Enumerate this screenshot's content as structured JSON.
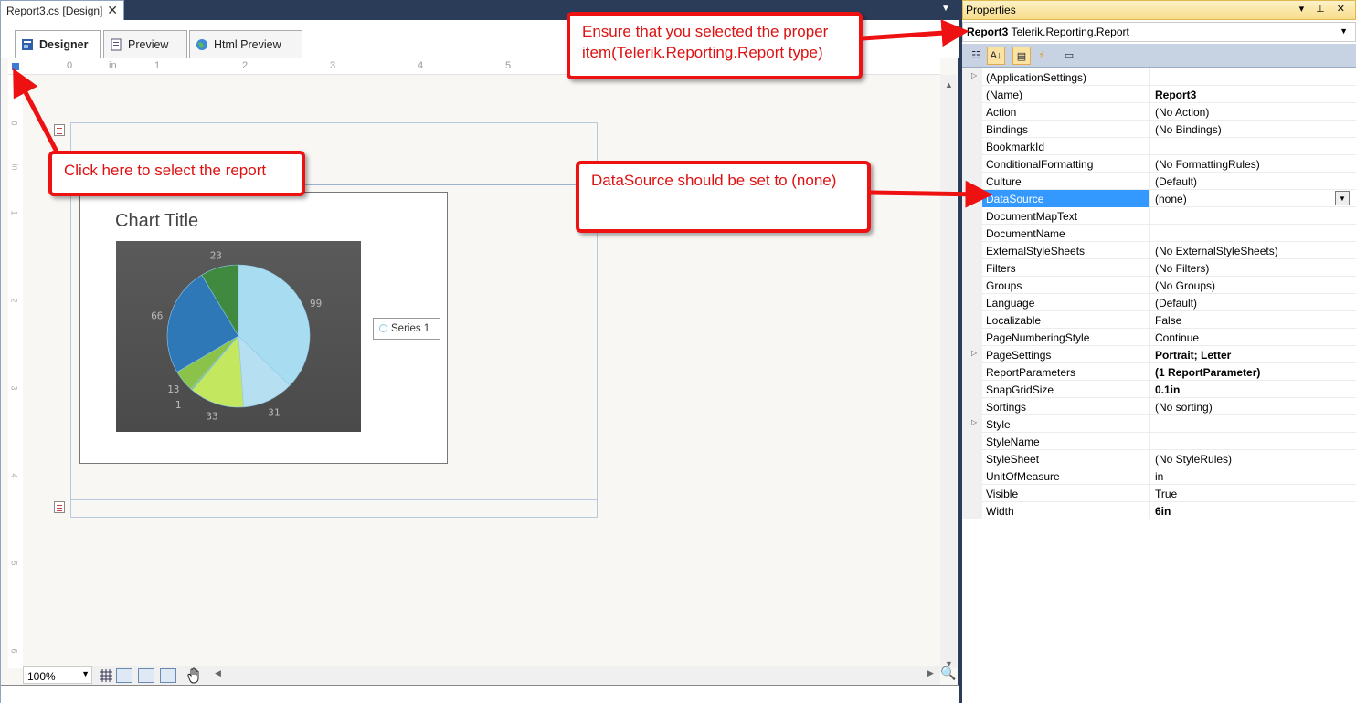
{
  "document": {
    "tab_title": "Report3.cs [Design]",
    "tab_close": "✕",
    "view_tabs": [
      {
        "label": "Designer",
        "active": true
      },
      {
        "label": "Preview",
        "active": false
      },
      {
        "label": "Html Preview",
        "active": false
      }
    ],
    "ruler_marks": [
      "0",
      "in",
      "1",
      "2",
      "3",
      "4",
      "5"
    ],
    "vruler_marks": [
      "0",
      "in",
      "1",
      "2",
      "3",
      "4",
      "5",
      "6"
    ],
    "zoom": "100%"
  },
  "chart": {
    "title": "Chart Title",
    "legend": "Series 1",
    "colors": [
      "#a8dcf0",
      "#b6e0f2",
      "#c3e860",
      "#8bc34a",
      "#2e78b8",
      "#3f8a3f"
    ],
    "plot_bg": "#555555"
  },
  "chart_data": {
    "type": "pie",
    "title": "Chart Title",
    "series": [
      {
        "name": "Series 1",
        "labels": [
          "99",
          "31",
          "33",
          "1",
          "13",
          "66",
          "23"
        ],
        "values": [
          99,
          31,
          33,
          1,
          13,
          66,
          23
        ]
      }
    ]
  },
  "properties": {
    "panel_title": "Properties",
    "panel_buttons": "▾ ⊥ ✕",
    "selected_object_name": "Report3",
    "selected_object_type": "Telerik.Reporting.Report",
    "rows": [
      {
        "name": "(ApplicationSettings)",
        "value": "",
        "expander": true
      },
      {
        "name": "(Name)",
        "value": "Report3",
        "bold": true
      },
      {
        "name": "Action",
        "value": "(No Action)"
      },
      {
        "name": "Bindings",
        "value": "(No Bindings)"
      },
      {
        "name": "BookmarkId",
        "value": ""
      },
      {
        "name": "ConditionalFormatting",
        "value": "(No FormattingRules)"
      },
      {
        "name": "Culture",
        "value": "(Default)"
      },
      {
        "name": "DataSource",
        "value": "(none)",
        "selected": true
      },
      {
        "name": "DocumentMapText",
        "value": ""
      },
      {
        "name": "DocumentName",
        "value": ""
      },
      {
        "name": "ExternalStyleSheets",
        "value": "(No ExternalStyleSheets)"
      },
      {
        "name": "Filters",
        "value": "(No Filters)"
      },
      {
        "name": "Groups",
        "value": "(No Groups)"
      },
      {
        "name": "Language",
        "value": "(Default)"
      },
      {
        "name": "Localizable",
        "value": "False"
      },
      {
        "name": "PageNumberingStyle",
        "value": "Continue"
      },
      {
        "name": "PageSettings",
        "value": "Portrait; Letter",
        "bold": true,
        "expander": true
      },
      {
        "name": "ReportParameters",
        "value": "(1 ReportParameter)",
        "bold": true
      },
      {
        "name": "SnapGridSize",
        "value": "0.1in",
        "bold": true
      },
      {
        "name": "Sortings",
        "value": "(No sorting)"
      },
      {
        "name": "Style",
        "value": "",
        "expander": true
      },
      {
        "name": "StyleName",
        "value": ""
      },
      {
        "name": "StyleSheet",
        "value": "(No StyleRules)"
      },
      {
        "name": "UnitOfMeasure",
        "value": "in"
      },
      {
        "name": "Visible",
        "value": "True"
      },
      {
        "name": "Width",
        "value": "6in",
        "bold": true
      }
    ]
  },
  "callouts": {
    "select_report": "Click here to select the report",
    "proper_item": "Ensure that you selected the proper item(Telerik.Reporting.Report type)",
    "datasource": "DataSource should be set to (none)"
  }
}
